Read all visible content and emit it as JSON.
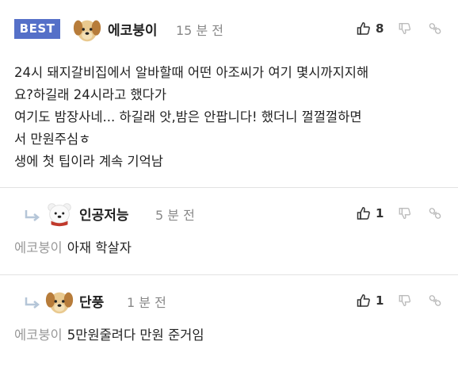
{
  "best_comment": {
    "badge": "BEST",
    "nickname": "에코붕이",
    "time": "15 분 전",
    "likes": "8",
    "lines": [
      "24시 돼지갈비집에서 알바할때 어떤 아조씨가 여기 몇시까지지해",
      "요?하길래 24시라고 했다가",
      "여기도 밤장사네... 하길래 앗,밤은 안팝니다! 했더니 껄껄껄하면",
      "서 만원주심ㅎ",
      "생에 첫 팁이라 계속 기억남"
    ]
  },
  "reply1": {
    "nickname": "인공저능",
    "time": "5 분 전",
    "likes": "1",
    "mention": "에코붕이",
    "text": "아재 학살자"
  },
  "reply2": {
    "nickname": "단풍",
    "time": "1 분 전",
    "likes": "1",
    "mention": "에코붕이",
    "text": "5만원줄려다 만원 준거임"
  },
  "colors": {
    "badge": "#5570c8",
    "text": "#222222",
    "muted": "#999999",
    "divider": "#e2e2e2"
  },
  "icons": {
    "like": "thumbs-up-icon",
    "dislike": "thumbs-down-icon",
    "link": "link-icon",
    "reply": "reply-arrow-icon",
    "avatar_dog": "puppy-avatar",
    "avatar_bear": "polar-bear-avatar"
  }
}
